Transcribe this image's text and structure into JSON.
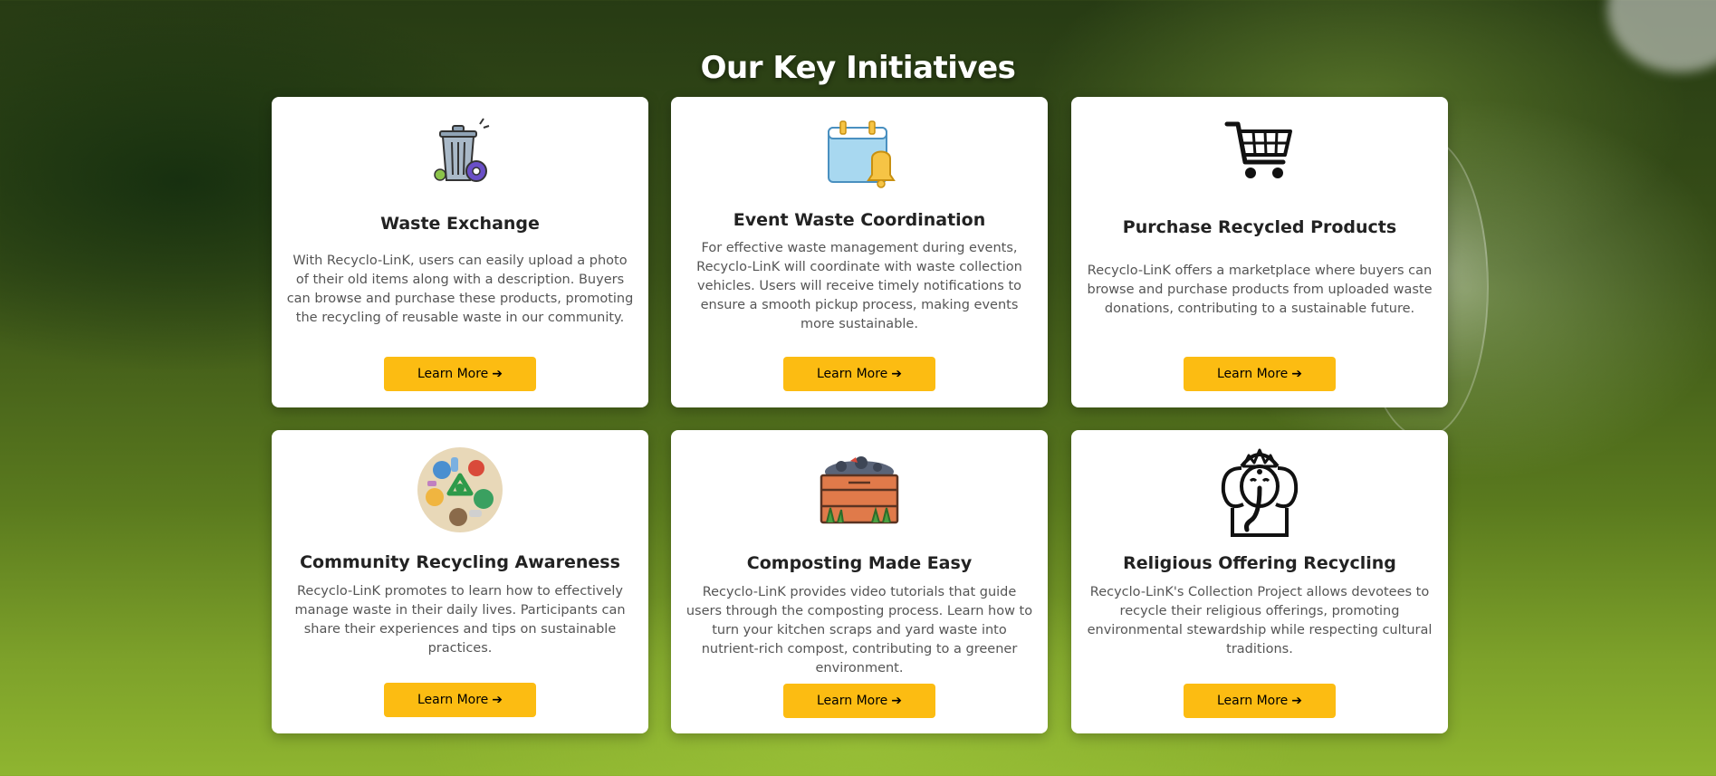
{
  "section": {
    "title": "Our Key Initiatives"
  },
  "colors": {
    "button": "#fcbc12",
    "card": "#ffffff",
    "title_text": "#ffffff"
  },
  "cards": [
    {
      "title": "Waste Exchange",
      "icon": "trash-bin-gear-icon",
      "description": "With Recyclo-LinK, users can easily upload a photo of their old items along with a description. Buyers can browse and purchase these products, promoting the recycling of reusable waste in our community.",
      "button_label": "Learn More",
      "button_arrow": "➔"
    },
    {
      "title": "Event Waste Coordination",
      "icon": "calendar-bell-icon",
      "description": "For effective waste management during events, Recyclo-LinK will coordinate with waste collection vehicles. Users will receive timely notifications to ensure a smooth pickup process, making events more sustainable.",
      "button_label": "Learn More",
      "button_arrow": "➔"
    },
    {
      "title": "Purchase Recycled Products",
      "icon": "shopping-cart-icon",
      "description": "Recyclo-LinK offers a marketplace where buyers can browse and purchase products from uploaded waste donations, contributing to a sustainable future.",
      "button_label": "Learn More",
      "button_arrow": "➔"
    },
    {
      "title": "Community Recycling Awareness",
      "icon": "recycling-globe-icon",
      "description": "Recyclo-LinK promotes to learn how to effectively manage waste in their daily lives. Participants can share their experiences and tips on sustainable practices.",
      "button_label": "Learn More",
      "button_arrow": "➔"
    },
    {
      "title": "Composting Made Easy",
      "icon": "compost-bin-icon",
      "description": "Recyclo-LinK provides video tutorials that guide users through the composting process. Learn how to turn your kitchen scraps and yard waste into nutrient-rich compost, contributing to a greener environment.",
      "button_label": "Learn More",
      "button_arrow": "➔"
    },
    {
      "title": "Religious Offering Recycling",
      "icon": "ganesha-icon",
      "description": "Recyclo-LinK's Collection Project allows devotees to recycle their religious offerings, promoting environmental stewardship while respecting cultural traditions.",
      "button_label": "Learn More",
      "button_arrow": "➔"
    }
  ]
}
